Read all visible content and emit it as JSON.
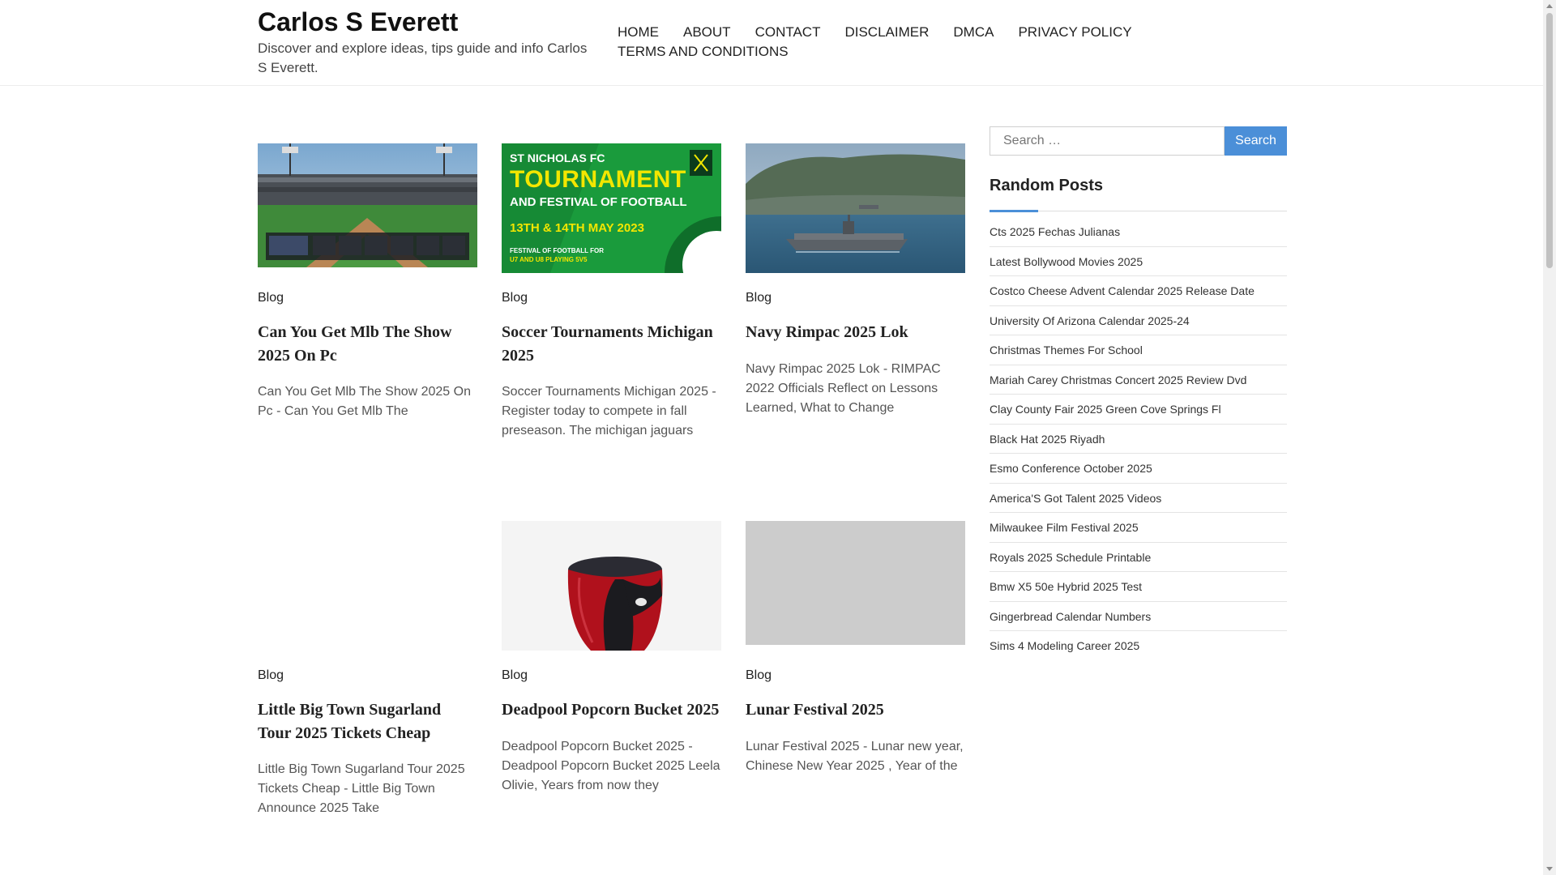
{
  "header": {
    "site_title": "Carlos S Everett",
    "site_description": "Discover and explore ideas, tips guide and info Carlos S Everett.",
    "nav": [
      "HOME",
      "ABOUT",
      "CONTACT",
      "DISCLAIMER",
      "DMCA",
      "PRIVACY POLICY",
      "TERMS AND CONDITIONS"
    ]
  },
  "posts": [
    {
      "category": "Blog",
      "title": "Can You Get Mlb The Show 2025 On Pc",
      "excerpt": "Can You Get Mlb The Show 2025 On Pc - Can You Get Mlb The",
      "image": "baseball-stadium-image"
    },
    {
      "category": "Blog",
      "title": "Soccer Tournaments Michigan 2025",
      "excerpt": "Soccer Tournaments Michigan 2025 - Register today to compete in fall preseason. The michigan jaguars",
      "image": "tournament-banner-image",
      "image_text": {
        "club": "ST NICHOLAS FC",
        "headline": "TOURNAMENT",
        "subhead": "AND FESTIVAL OF FOOTBALL",
        "dates": "13TH & 14TH MAY 2023",
        "note1": "FESTIVAL OF FOOTBALL FOR",
        "note2": "U7 AND U8 PLAYING 5V5"
      }
    },
    {
      "category": "Blog",
      "title": "Navy Rimpac 2025 Lok",
      "excerpt": "Navy Rimpac 2025 Lok - RIMPAC 2022 Officials Reflect on Lessons Learned, What to Change",
      "image": "navy-ship-image"
    },
    {
      "category": "Blog",
      "title": "Little Big Town Sugarland Tour 2025 Tickets Cheap",
      "excerpt": "Little Big Town Sugarland Tour 2025 Tickets Cheap - Little Big Town Announce 2025 Take",
      "image": ""
    },
    {
      "category": "Blog",
      "title": "Deadpool Popcorn Bucket 2025",
      "excerpt": "Deadpool Popcorn Bucket 2025 - Deadpool Popcorn Bucket 2025 Leela Olivie, Years from now they",
      "image": "deadpool-bucket-image"
    },
    {
      "category": "Blog",
      "title": "Lunar Festival 2025",
      "excerpt": "Lunar Festival 2025 - Lunar new year, Chinese New Year 2025 , Year of the",
      "image": "grey-placeholder-image"
    }
  ],
  "sidebar": {
    "search_placeholder": "Search …",
    "search_button": "Search",
    "widget_title": "Random Posts",
    "random_posts": [
      "Cts 2025 Fechas Julianas",
      "Latest Bollywood Movies 2025",
      "Costco Cheese Advent Calendar 2025 Release Date",
      "University Of Arizona Calendar 2025-24",
      "Christmas Themes For School",
      "Mariah Carey Christmas Concert 2025 Review Dvd",
      "Clay County Fair 2025 Green Cove Springs Fl",
      "Black Hat 2025 Riyadh",
      "Esmo Conference October 2025",
      "America'S Got Talent 2025 Videos",
      "Milwaukee Film Festival 2025",
      "Royals 2025 Schedule Printable",
      "Bmw X5 50e Hybrid 2025 Test",
      "Gingerbread Calendar Numbers",
      "Sims 4 Modeling Career 2025"
    ]
  },
  "colors": {
    "accent": "#4b8fd8",
    "text": "#222222",
    "soccer_green": "#1a9b3c",
    "soccer_yellow": "#f3e600"
  }
}
